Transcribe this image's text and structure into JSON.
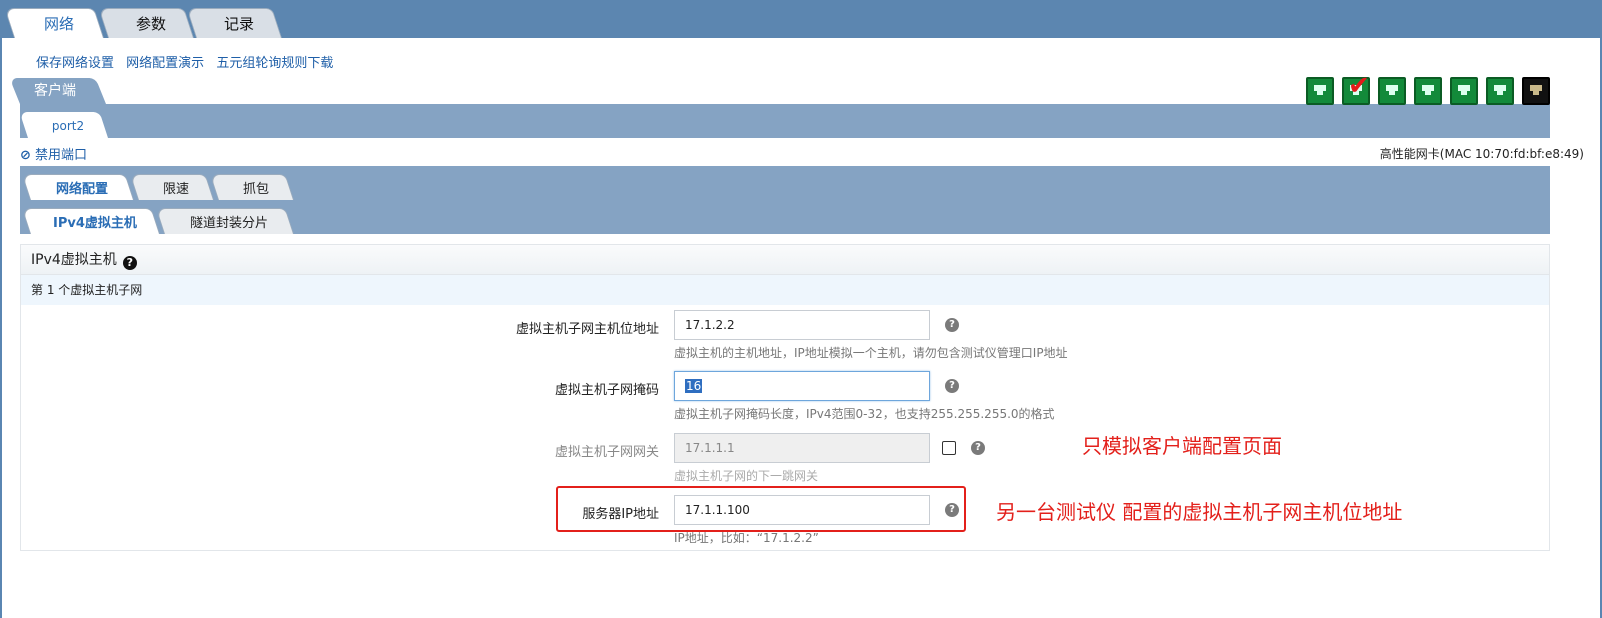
{
  "main_tabs": [
    "网络",
    "参数",
    "记录"
  ],
  "links": [
    "保存网络设置",
    "网络配置演示",
    "五元组轮询规则下载"
  ],
  "client_tab": "客户端",
  "port_tab": "port2",
  "disable_port": "禁用端口",
  "nic_info": "高性能网卡(MAC 10:70:fd:bf:e8:49)",
  "sub_tabs": [
    "网络配置",
    "限速",
    "抓包"
  ],
  "sub_tabs2": [
    "IPv4虚拟主机",
    "隧道封装分片"
  ],
  "panel": {
    "title": "IPv4虚拟主机",
    "subnet_title": "第 1 个虚拟主机子网"
  },
  "fields": [
    {
      "label": "虚拟主机子网主机位地址",
      "value": "17.1.2.2",
      "hint": "虚拟主机的主机地址，IP地址模拟一个主机，请勿包含测试仪管理口IP地址"
    },
    {
      "label": "虚拟主机子网掩码",
      "value": "16",
      "hint": "虚拟主机子网掩码长度，IPv4范围0-32，也支持255.255.255.0的格式"
    },
    {
      "label": "虚拟主机子网网关",
      "value": "17.1.1.1",
      "hint": "虚拟主机子网的下一跳网关"
    },
    {
      "label": "服务器IP地址",
      "value": "17.1.1.100",
      "hint": "IP地址，比如：“17.1.2.2”"
    }
  ],
  "annotations": {
    "client_only": "只模拟客户端配置页面",
    "server_ip_note": "另一台测试仪 配置的虚拟主机子网主机位地址"
  },
  "port_icons": [
    "network-port-icon",
    "network-port-checked-icon",
    "network-port-icon",
    "network-port-icon",
    "network-port-icon",
    "network-port-icon",
    "network-port-dark-icon"
  ],
  "colors": {
    "header": "#5c86b0",
    "band": "#85a3c3",
    "link": "#1f5fa8",
    "annotation": "#e3201b"
  }
}
